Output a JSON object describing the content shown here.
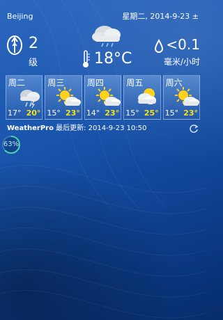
{
  "header": {
    "city": "Beijing",
    "date": "星期二, 2014-9-23 ±"
  },
  "wind": {
    "level": "2",
    "unit": "级",
    "icon": "wind-icon"
  },
  "current": {
    "temperature": "18°C",
    "icon": "cloud-rain-icon"
  },
  "rain": {
    "amount": "<0.1",
    "unit": "毫米/小时",
    "icon": "raindrop-icon"
  },
  "forecast": [
    {
      "day": "周二",
      "low": "17°",
      "high": "20°",
      "icon": "cloud-rain-icon"
    },
    {
      "day": "周三",
      "low": "15°",
      "high": "23°",
      "icon": "partly-sunny-icon"
    },
    {
      "day": "周四",
      "low": "14°",
      "high": "23°",
      "icon": "partly-sunny-icon"
    },
    {
      "day": "周五",
      "low": "15°",
      "high": "25°",
      "icon": "sun-cloud-icon"
    },
    {
      "day": "周六",
      "low": "15°",
      "high": "23°",
      "icon": "partly-sunny-icon"
    }
  ],
  "footer": {
    "brand": "WeatherPro",
    "updated": " 最后更新: 2014-9-23 10:50"
  },
  "battery": {
    "percent": "63%",
    "level": 0.63
  },
  "colors": {
    "high_temp": "#f4e21a",
    "background": "#1a55ad"
  }
}
